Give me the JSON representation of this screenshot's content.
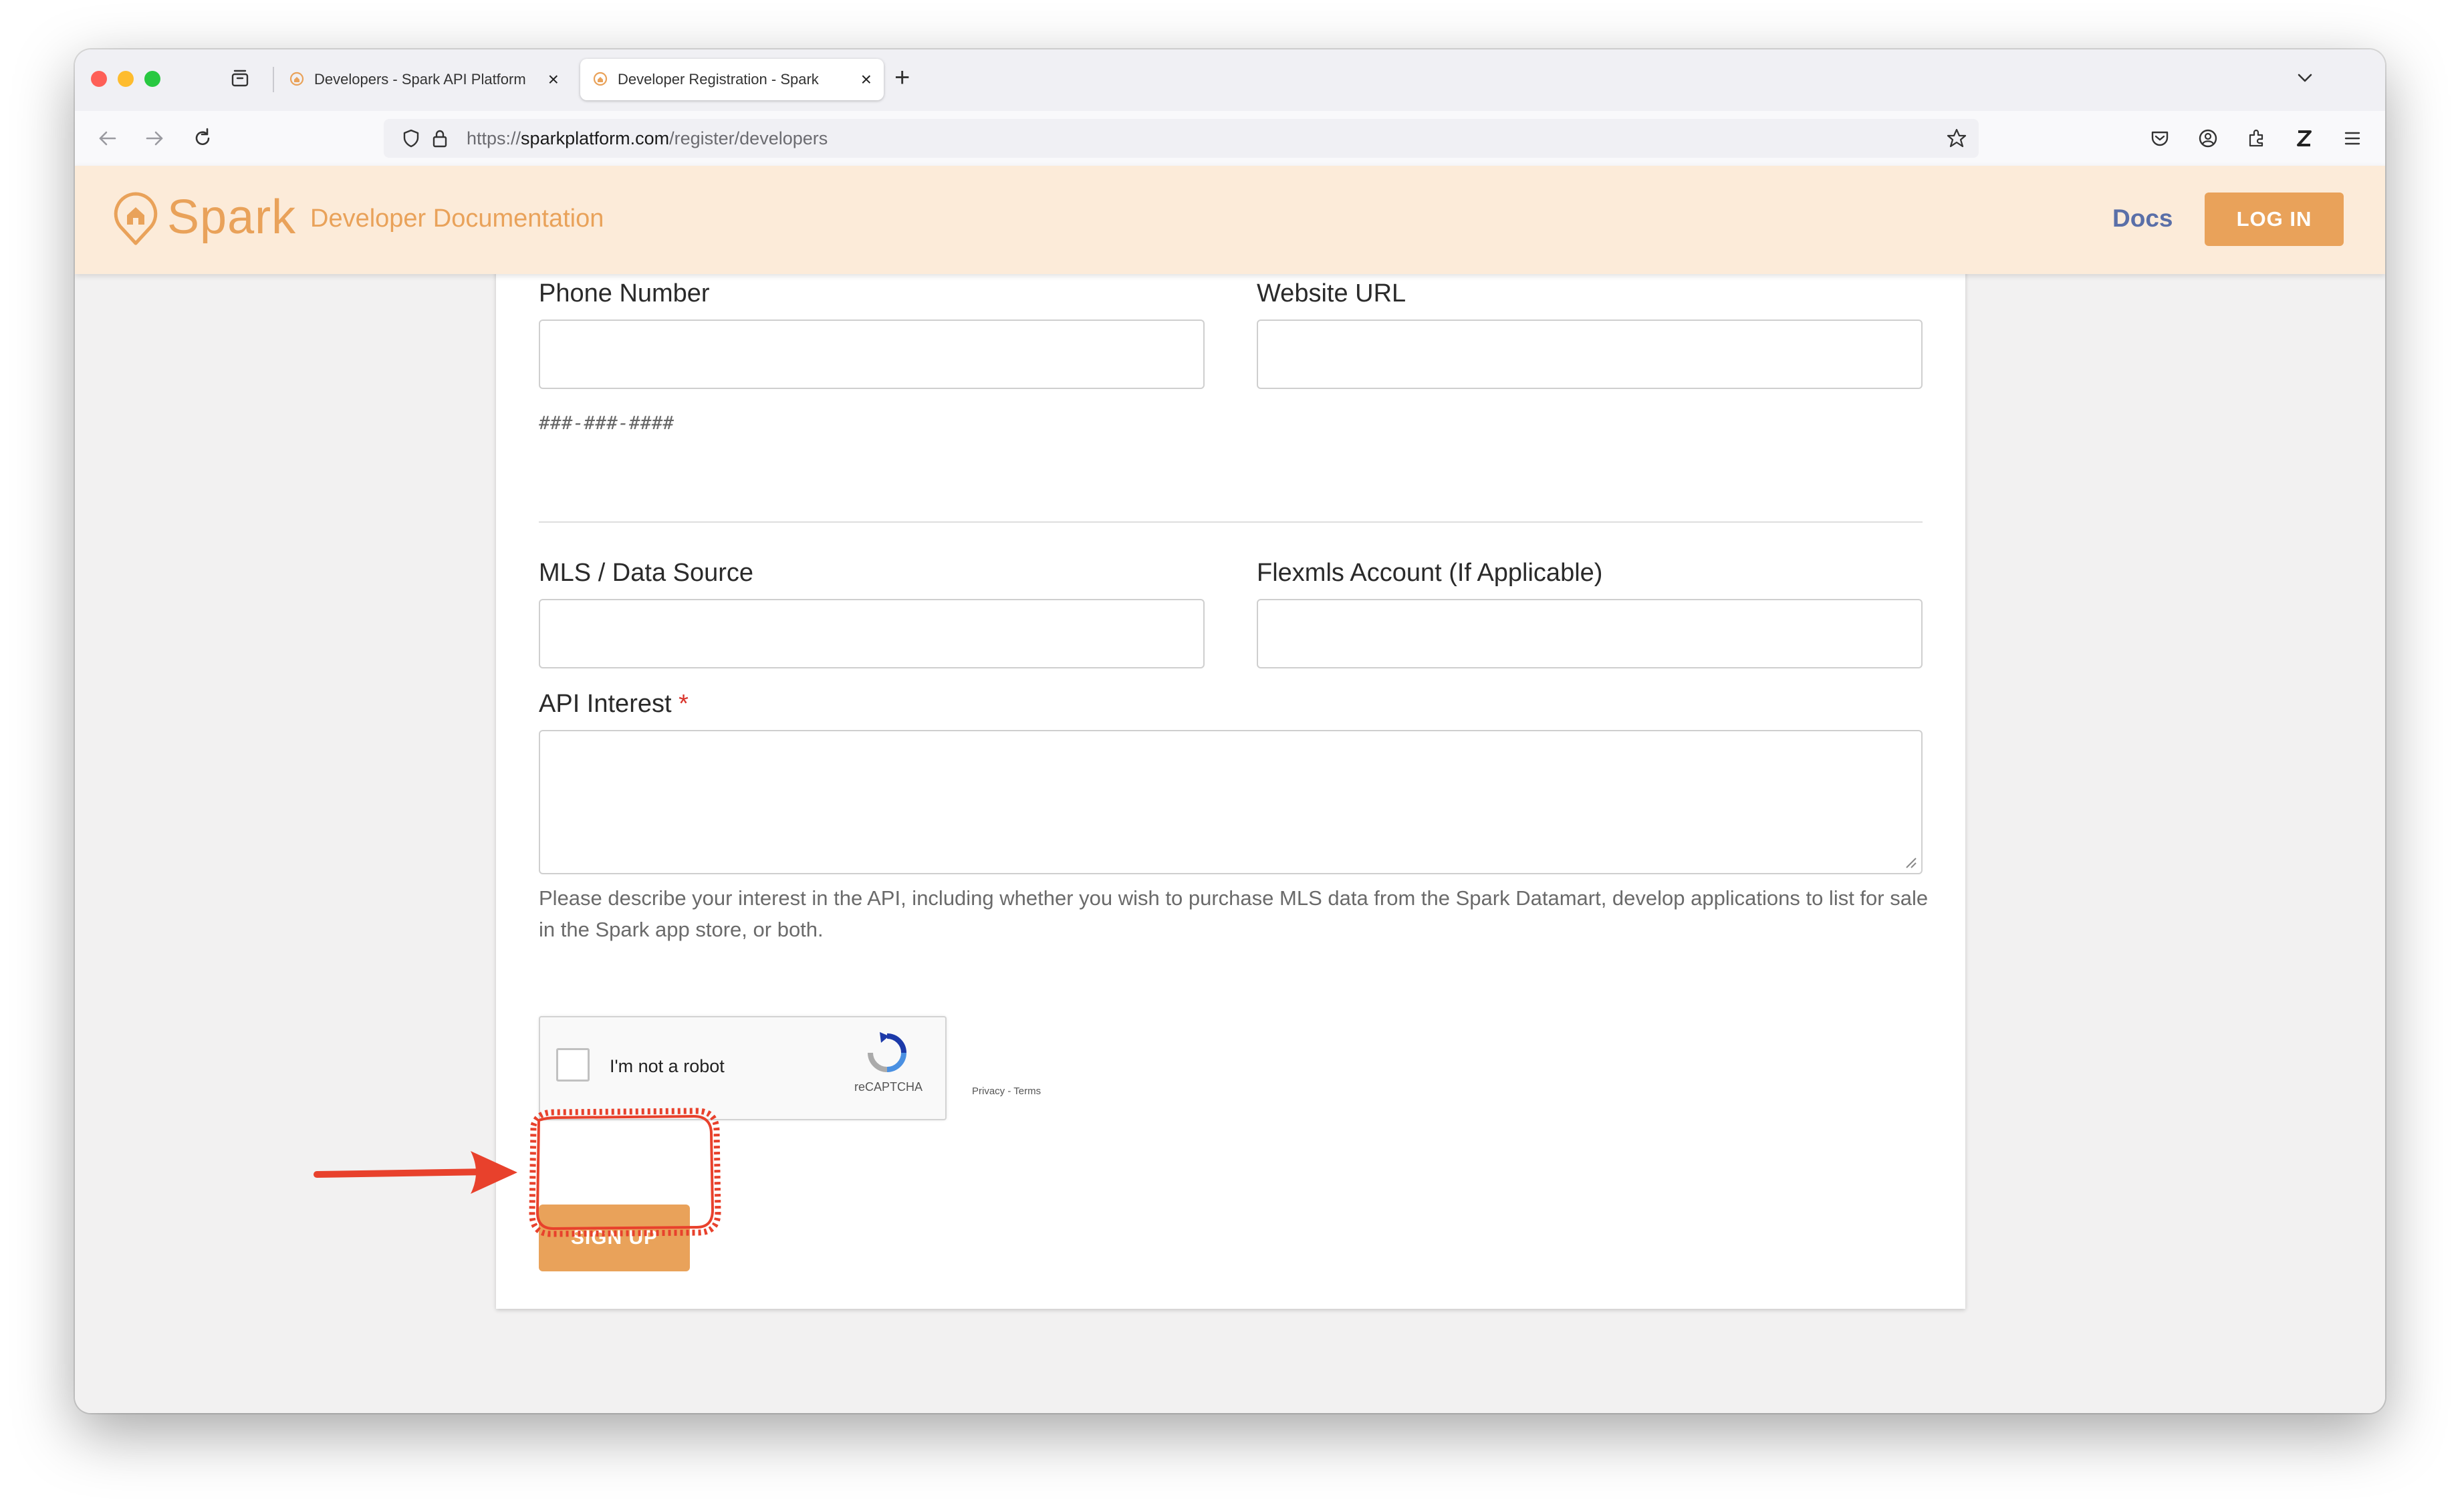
{
  "browser": {
    "tabs": [
      {
        "title": "Developers - Spark API Platform",
        "active": false
      },
      {
        "title": "Developer Registration - Spark",
        "active": true
      }
    ],
    "url_scheme": "https://",
    "url_domain": "sparkplatform.com",
    "url_path": "/register/developers"
  },
  "header": {
    "brand": "Spark",
    "subtitle": "Developer Documentation",
    "docs_link": "Docs",
    "login_label": "LOG IN"
  },
  "form": {
    "phone_label": "Phone Number",
    "phone_hint": "###-###-####",
    "website_label": "Website URL",
    "mls_label": "MLS / Data Source",
    "flexmls_label": "Flexmls Account (If Applicable)",
    "api_interest_label": "API Interest",
    "required_marker": "*",
    "api_interest_help": "Please describe your interest in the API, including whether you wish to purchase MLS data from the Spark Datamart, develop applications to list for sale in the Spark app store, or both.",
    "captcha_text": "I'm not a robot",
    "captcha_brand": "reCAPTCHA",
    "captcha_terms": "Privacy - Terms",
    "signup_label": "SIGN UP"
  },
  "colors": {
    "brand": "#e9a25a",
    "header_bg": "#fcebd9",
    "docs_link": "#5a6fa8",
    "annotation": "#e8412c"
  },
  "icons": [
    "tab-list-icon",
    "spark-favicon",
    "close-icon",
    "plus-icon",
    "chevron-down-icon",
    "back-icon",
    "forward-icon",
    "reload-icon",
    "shield-icon",
    "lock-icon",
    "star-icon",
    "pocket-icon",
    "account-icon",
    "extensions-icon",
    "zotero-icon",
    "menu-icon",
    "spark-logo-icon",
    "resize-handle-icon",
    "recaptcha-icon",
    "arrow-annotation"
  ]
}
